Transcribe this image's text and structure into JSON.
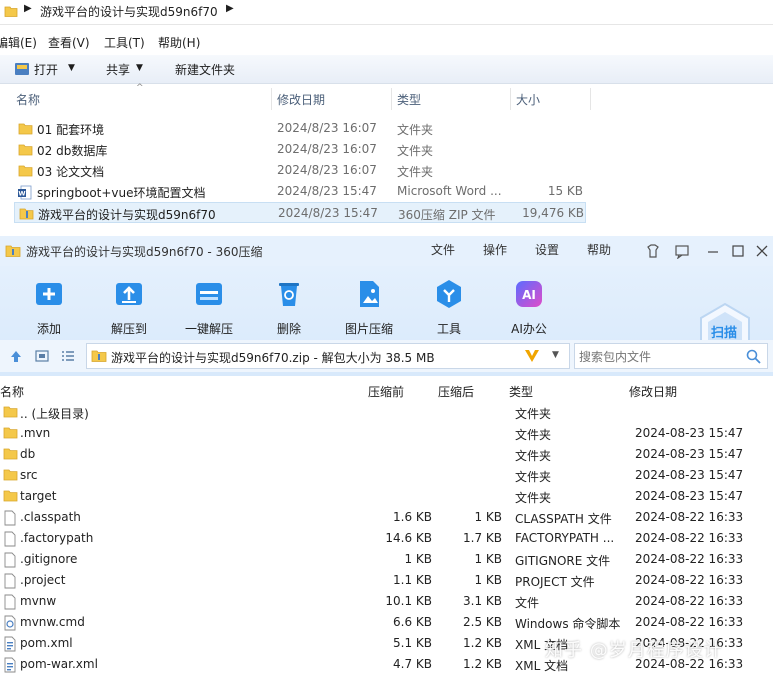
{
  "explorer": {
    "breadcrumb": "游戏平台的设计与实现d59n6f70",
    "menu": [
      "编辑(E)",
      "查看(V)",
      "工具(T)",
      "帮助(H)"
    ],
    "commands": {
      "open": "打开",
      "share": "共享",
      "new_folder": "新建文件夹"
    },
    "columns": {
      "name": "名称",
      "date": "修改日期",
      "type": "类型",
      "size": "大小"
    },
    "files": [
      {
        "name": "01 配套环境",
        "date": "2024/8/23 16:07",
        "type": "文件夹",
        "size": "",
        "icon": "folder-icon"
      },
      {
        "name": "02 db数据库",
        "date": "2024/8/23 16:07",
        "type": "文件夹",
        "size": "",
        "icon": "folder-icon"
      },
      {
        "name": "03 论文文档",
        "date": "2024/8/23 16:07",
        "type": "文件夹",
        "size": "",
        "icon": "folder-icon"
      },
      {
        "name": "springboot+vue环境配置文档",
        "date": "2024/8/23 15:47",
        "type": "Microsoft Word ...",
        "size": "15 KB",
        "icon": "word-doc-icon"
      },
      {
        "name": "游戏平台的设计与实现d59n6f70",
        "date": "2024/8/23 15:47",
        "type": "360压缩 ZIP 文件",
        "size": "19,476 KB",
        "icon": "zip-icon",
        "selected": true
      }
    ]
  },
  "zip": {
    "title": "游戏平台的设计与实现d59n6f70 - 360压缩",
    "title_menu": [
      "文件",
      "操作",
      "设置",
      "帮助"
    ],
    "toolbar": [
      "添加",
      "解压到",
      "一键解压",
      "删除",
      "图片压缩",
      "工具",
      "AI办公"
    ],
    "scan_label": "扫描",
    "path_text": "游戏平台的设计与实现d59n6f70.zip - 解包大小为 38.5 MB",
    "search_placeholder": "搜索包内文件",
    "columns": {
      "name": "名称",
      "size": "压缩前",
      "csize": "压缩后",
      "type": "类型",
      "date": "修改日期"
    },
    "items": [
      {
        "name": ".. (上级目录)",
        "size": "",
        "csize": "",
        "type": "文件夹",
        "date": "",
        "icon": "folder-icon"
      },
      {
        "name": ".mvn",
        "size": "",
        "csize": "",
        "type": "文件夹",
        "date": "2024-08-23 15:47",
        "icon": "folder-icon"
      },
      {
        "name": "db",
        "size": "",
        "csize": "",
        "type": "文件夹",
        "date": "2024-08-23 15:47",
        "icon": "folder-icon"
      },
      {
        "name": "src",
        "size": "",
        "csize": "",
        "type": "文件夹",
        "date": "2024-08-23 15:47",
        "icon": "folder-icon"
      },
      {
        "name": "target",
        "size": "",
        "csize": "",
        "type": "文件夹",
        "date": "2024-08-23 15:47",
        "icon": "folder-icon"
      },
      {
        "name": ".classpath",
        "size": "1.6 KB",
        "csize": "1 KB",
        "type": "CLASSPATH 文件",
        "date": "2024-08-22 16:33",
        "icon": "file-icon"
      },
      {
        "name": ".factorypath",
        "size": "14.6 KB",
        "csize": "1.7 KB",
        "type": "FACTORYPATH ...",
        "date": "2024-08-22 16:33",
        "icon": "file-icon"
      },
      {
        "name": ".gitignore",
        "size": "1 KB",
        "csize": "1 KB",
        "type": "GITIGNORE 文件",
        "date": "2024-08-22 16:33",
        "icon": "file-icon"
      },
      {
        "name": ".project",
        "size": "1.1 KB",
        "csize": "1 KB",
        "type": "PROJECT 文件",
        "date": "2024-08-22 16:33",
        "icon": "file-icon"
      },
      {
        "name": "mvnw",
        "size": "10.1 KB",
        "csize": "3.1 KB",
        "type": "文件",
        "date": "2024-08-22 16:33",
        "icon": "file-icon"
      },
      {
        "name": "mvnw.cmd",
        "size": "6.6 KB",
        "csize": "2.5 KB",
        "type": "Windows 命令脚本",
        "date": "2024-08-22 16:33",
        "icon": "cmd-script-icon"
      },
      {
        "name": "pom.xml",
        "size": "5.1 KB",
        "csize": "1.2 KB",
        "type": "XML 文档",
        "date": "2024-08-22 16:33",
        "icon": "xml-file-icon"
      },
      {
        "name": "pom-war.xml",
        "size": "4.7 KB",
        "csize": "1.2 KB",
        "type": "XML 文档",
        "date": "2024-08-22 16:33",
        "icon": "xml-file-icon"
      }
    ]
  },
  "watermark": "知乎 @岁月程序设计",
  "colors": {
    "accent": "#2a8ee8",
    "folder": "#f4c84a",
    "toolbar_bg": "#dceafb"
  }
}
